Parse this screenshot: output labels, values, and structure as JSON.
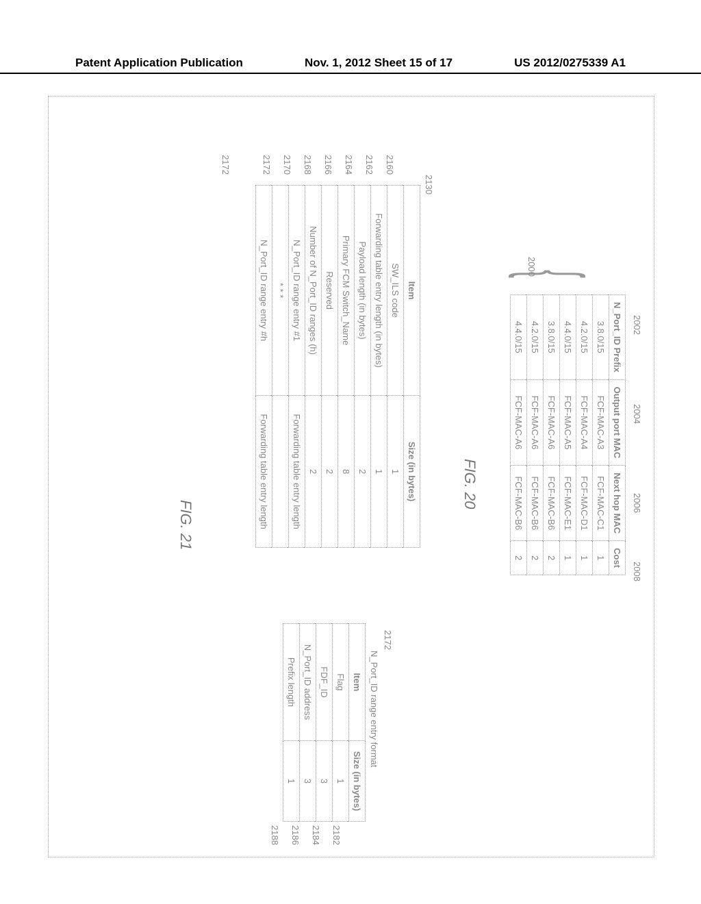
{
  "header": {
    "left": "Patent Application Publication",
    "center": "Nov. 1, 2012  Sheet 15 of 17",
    "right": "US 2012/0275339 A1"
  },
  "fig20": {
    "label": "FIG. 20",
    "table_ref": "2000",
    "columns": [
      {
        "ref": "2002",
        "label": "N_Port_ID Prefix"
      },
      {
        "ref": "2004",
        "label": "Output port MAC"
      },
      {
        "ref": "2006",
        "label": "Next hop MAC"
      },
      {
        "ref": "2008",
        "label": "Cost"
      }
    ],
    "rows": [
      {
        "prefix": "3.8.0/15",
        "out": "FCF-MAC-A3",
        "next": "FCF-MAC-C1",
        "cost": "1"
      },
      {
        "prefix": "4.2.0/15",
        "out": "FCF-MAC-A4",
        "next": "FCF-MAC-D1",
        "cost": "1"
      },
      {
        "prefix": "4.4.0/15",
        "out": "FCF-MAC-A5",
        "next": "FCF-MAC-E1",
        "cost": "1"
      },
      {
        "prefix": "3.8.0/15",
        "out": "FCF-MAC-A6",
        "next": "FCF-MAC-B6",
        "cost": "2"
      },
      {
        "prefix": "4.2.0/15",
        "out": "FCF-MAC-A6",
        "next": "FCF-MAC-B6",
        "cost": "2"
      },
      {
        "prefix": "4.4.0/15",
        "out": "FCF-MAC-A6",
        "next": "FCF-MAC-B6",
        "cost": "2"
      }
    ]
  },
  "fig21": {
    "label": "FIG. 21",
    "left_ref": "2130",
    "left_header": {
      "item": "Item",
      "size": "Size (in bytes)"
    },
    "left_rows": [
      {
        "ref": "2160",
        "item": "SW_ILS code",
        "size": "1"
      },
      {
        "ref": "2162",
        "item": "Forwarding table entry length (in bytes)",
        "size": "1"
      },
      {
        "ref": "2164",
        "item": "Payload length (in bytes)",
        "size": "2"
      },
      {
        "ref": "2166",
        "item": "Primary FCM Switch_Name",
        "size": "8"
      },
      {
        "ref": "2168",
        "item": "Reserved",
        "size": "2"
      },
      {
        "ref": "2170",
        "item": "Number of N_Port_ID ranges (h)",
        "size": "2"
      },
      {
        "ref": "2172",
        "item": "N_Port_ID range entry #1",
        "size": "Forwarding table entry length"
      },
      {
        "ref": "",
        "item": "* * *",
        "size": ""
      },
      {
        "ref": "2172",
        "item": "N_Port_ID range entry #h",
        "size": "Forwarding table entry length"
      }
    ],
    "right_ref": "2172",
    "right_title": "N_Port_ID range entry format",
    "right_header": {
      "item": "Item",
      "size": "Size (in bytes)"
    },
    "right_rows": [
      {
        "ref": "2182",
        "item": "Flag",
        "size": "1"
      },
      {
        "ref": "2184",
        "item": "FDF_ID",
        "size": "3"
      },
      {
        "ref": "2186",
        "item": "N_Port_ID address",
        "size": "3"
      },
      {
        "ref": "2188",
        "item": "Prefix length",
        "size": "1"
      }
    ]
  }
}
